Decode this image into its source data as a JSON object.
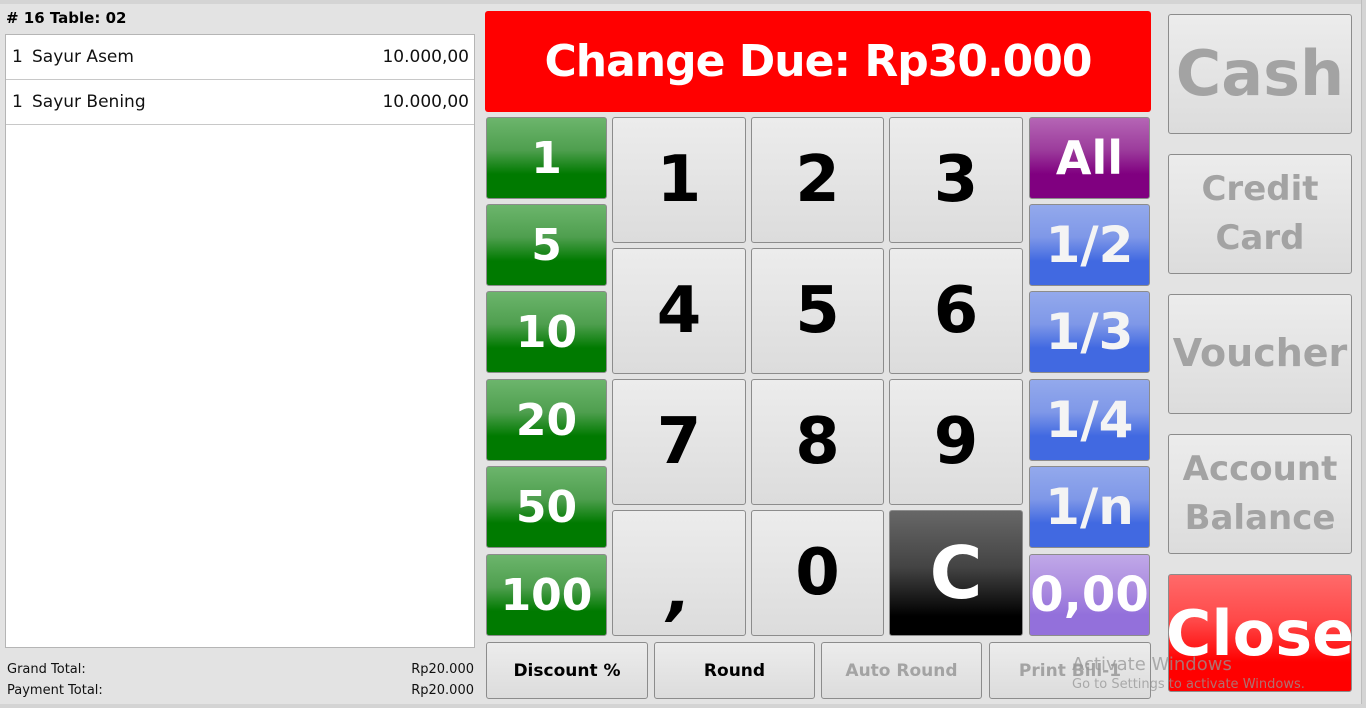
{
  "order": {
    "title": "# 16 Table: 02",
    "items": [
      {
        "qty": "1",
        "name": "Sayur Asem",
        "price": "10.000,00"
      },
      {
        "qty": "1",
        "name": "Sayur Bening",
        "price": "10.000,00"
      }
    ],
    "grand_total_label": "Grand Total:",
    "grand_total_value": "Rp20.000",
    "payment_total_label": "Payment Total:",
    "payment_total_value": "Rp20.000"
  },
  "change_due": "Change Due: Rp30.000",
  "quick_amounts": [
    "1",
    "5",
    "10",
    "20",
    "50",
    "100"
  ],
  "keypad": [
    "1",
    "2",
    "3",
    "4",
    "5",
    "6",
    "7",
    "8",
    "9",
    ",",
    "0",
    "C"
  ],
  "fractions": [
    "All",
    "1/2",
    "1/3",
    "1/4",
    "1/n",
    "0,00"
  ],
  "actions": {
    "discount": "Discount %",
    "round": "Round",
    "auto_round": "Auto Round",
    "print_bill": "Print Bill-1"
  },
  "payment_methods": {
    "cash": "Cash",
    "credit_card_line1": "Credit",
    "credit_card_line2": "Card",
    "voucher": "Voucher",
    "account_balance_line1": "Account",
    "account_balance_line2": "Balance",
    "close": "Close"
  },
  "watermark": {
    "line1": "Activate Windows",
    "line2": "Go to Settings to activate Windows."
  },
  "colors": {
    "change_due_bg": "#ff0000",
    "quick_amount_green": "#007a00",
    "fraction_blue": "#4169e1",
    "all_purple": "#800080",
    "zero_lavender": "#9370db",
    "close_red": "#ff0000"
  }
}
